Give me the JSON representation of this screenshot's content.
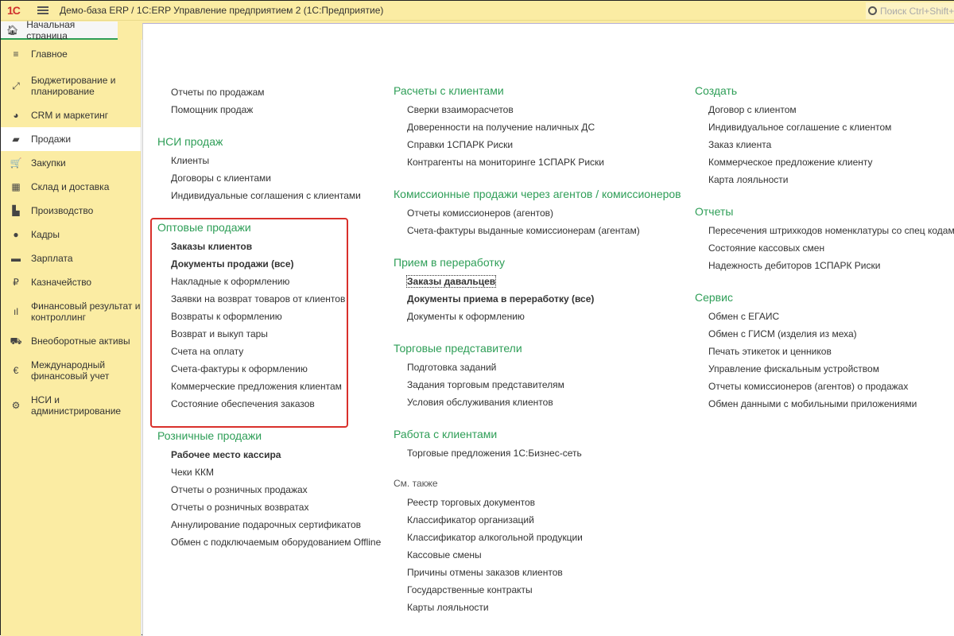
{
  "app": {
    "title": "Демо-база ERP / 1С:ERP Управление предприятием 2  (1С:Предприятие)",
    "logo": "1С",
    "search_placeholder": "Поиск Ctrl+Shift+F"
  },
  "tab": {
    "label": "Начальная страница"
  },
  "sidebar": [
    {
      "label": "Главное",
      "icon": "≡"
    },
    {
      "label": "Бюджетирование и планирование",
      "icon": "⤢"
    },
    {
      "label": "CRM и маркетинг",
      "icon": "◕"
    },
    {
      "label": "Продажи",
      "icon": "▰"
    },
    {
      "label": "Закупки",
      "icon": "🛒"
    },
    {
      "label": "Склад и доставка",
      "icon": "▦"
    },
    {
      "label": "Производство",
      "icon": "▙"
    },
    {
      "label": "Кадры",
      "icon": "●"
    },
    {
      "label": "Зарплата",
      "icon": "▬"
    },
    {
      "label": "Казначейство",
      "icon": "₽"
    },
    {
      "label": "Финансовый результат и контроллинг",
      "icon": "ıl"
    },
    {
      "label": "Внеоборотные активы",
      "icon": "⛟"
    },
    {
      "label": "Международный финансовый учет",
      "icon": "€"
    },
    {
      "label": "НСИ и администрирование",
      "icon": "⚙"
    }
  ],
  "col1": [
    {
      "title": "",
      "items": [
        "Отчеты по продажам",
        "Помощник продаж"
      ]
    },
    {
      "title": "НСИ продаж",
      "items": [
        "Клиенты",
        "Договоры с клиентами",
        "Индивидуальные соглашения с клиентами"
      ]
    },
    {
      "title": "Оптовые продажи",
      "items": [
        "Заказы клиентов",
        "Документы продажи (все)",
        "Накладные к оформлению",
        "Заявки на возврат товаров от клиентов",
        "Возвраты к оформлению",
        "Возврат и выкуп тары",
        "Счета на оплату",
        "Счета-фактуры к оформлению",
        "Коммерческие предложения клиентам",
        "Состояние обеспечения заказов"
      ]
    },
    {
      "title": "Розничные продажи",
      "items": [
        "Рабочее место кассира",
        "Чеки ККМ",
        "Отчеты о розничных продажах",
        "Отчеты о розничных возвратах",
        "Аннулирование подарочных сертификатов",
        "Обмен с подключаемым оборудованием Offline"
      ]
    }
  ],
  "col2": [
    {
      "title": "Расчеты с клиентами",
      "items": [
        "Сверки взаиморасчетов",
        "Доверенности на получение наличных ДС",
        "Справки 1СПАРК Риски",
        "Контрагенты на мониторинге 1СПАРК Риски"
      ]
    },
    {
      "title": "Комиссионные продажи через агентов / комиссионеров",
      "items": [
        "Отчеты комиссионеров (агентов)",
        "Счета-фактуры выданные комиссионерам (агентам)"
      ]
    },
    {
      "title": "Прием в переработку",
      "items": [
        "Заказы давальцев",
        "Документы приема в переработку (все)",
        "Документы к оформлению"
      ]
    },
    {
      "title": "Торговые представители",
      "items": [
        "Подготовка заданий",
        "Задания торговым представителям",
        "Условия обслуживания клиентов"
      ]
    },
    {
      "title": "Работа с клиентами",
      "items": [
        "Торговые предложения 1С:Бизнес-сеть"
      ]
    },
    {
      "title": "См. также",
      "items": [
        "Реестр торговых документов",
        "Классификатор организаций",
        "Классификатор алкогольной продукции",
        "Кассовые смены",
        "Причины отмены заказов клиентов",
        "Государственные контракты",
        "Карты лояльности"
      ]
    }
  ],
  "col3": [
    {
      "title": "Создать",
      "items": [
        "Договор с клиентом",
        "Индивидуальное соглашение с клиентом",
        "Заказ клиента",
        "Коммерческое предложение клиенту",
        "Карта лояльности"
      ]
    },
    {
      "title": "Отчеты",
      "items": [
        "Пересечения штрихкодов номенклатуры со спец кодами",
        "Состояние кассовых смен",
        "Надежность дебиторов 1СПАРК Риски"
      ]
    },
    {
      "title": "Сервис",
      "items": [
        "Обмен с ЕГАИС",
        "Обмен с ГИСМ (изделия из меха)",
        "Печать этикеток и ценников",
        "Управление фискальным устройством",
        "Отчеты комиссионеров (агентов) о продажах",
        "Обмен данными с мобильными приложениями"
      ]
    }
  ],
  "colors": {
    "accent": "#2e9e57",
    "panel": "#fbeca3",
    "highlight": "#d9302b"
  }
}
